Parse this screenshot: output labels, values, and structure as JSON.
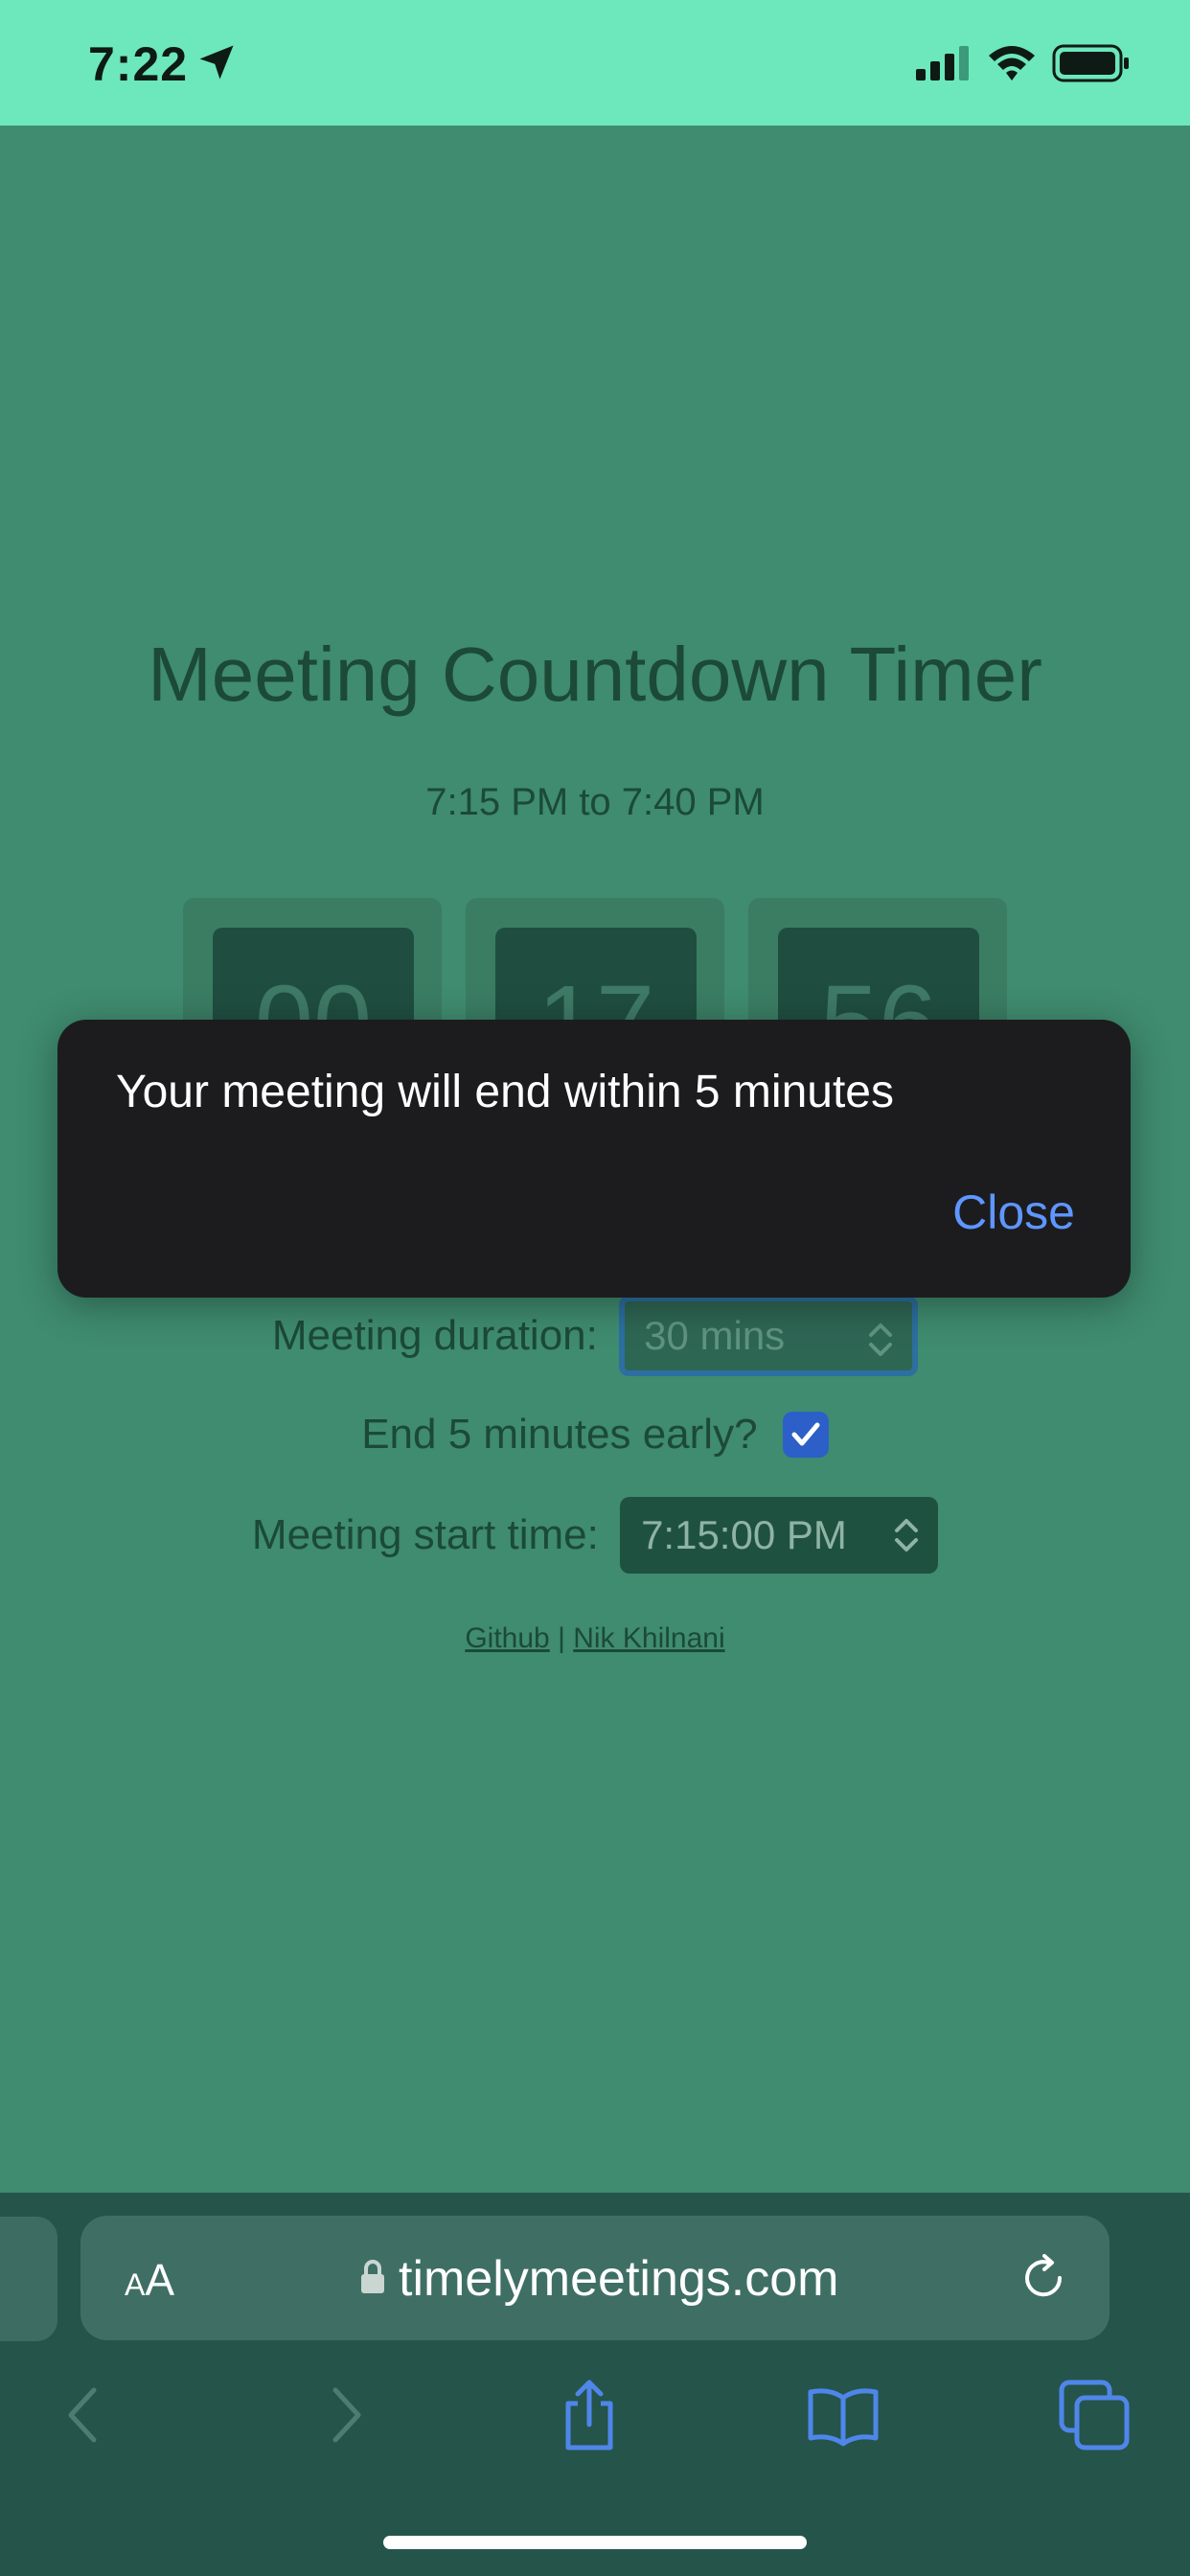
{
  "status_bar": {
    "time": "7:22",
    "icons": [
      "location-arrow-icon",
      "signal-icon",
      "wifi-icon",
      "battery-icon"
    ]
  },
  "page": {
    "title": "Meeting Countdown Timer",
    "time_range": "7:15 PM to 7:40 PM",
    "countdown": {
      "hours": "00",
      "minutes": "17",
      "seconds": "56"
    },
    "duration_label": "Meeting duration:",
    "duration_value": "30 mins",
    "end_early_label": "End 5 minutes early?",
    "end_early_checked": true,
    "start_time_label": "Meeting start time:",
    "start_time_value": "7:15:00 PM",
    "footer": {
      "link1": "Github",
      "separator": "|",
      "link2": "Nik Khilnani"
    }
  },
  "alert": {
    "message": "Your meeting will end within 5 minutes",
    "close_label": "Close"
  },
  "browser": {
    "text_size_label": "AA",
    "url": "timelymeetings.com"
  },
  "colors": {
    "status_bar_bg": "#6ce8bc",
    "page_bg": "#3f8c70",
    "alert_bg": "#1c1c1e",
    "accent_blue": "#5f96ff",
    "checkbox_blue": "#2d5fc8"
  }
}
